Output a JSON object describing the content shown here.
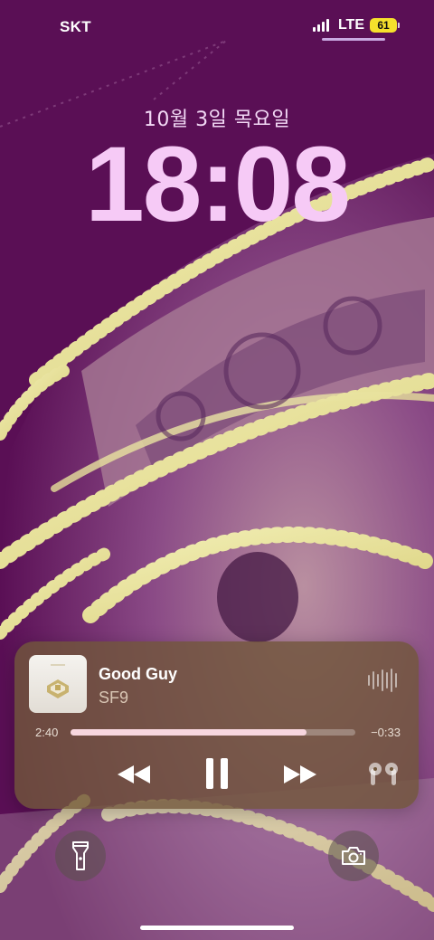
{
  "status_bar": {
    "carrier": "SKT",
    "network": "LTE",
    "battery": "61",
    "battery_level": 0.61,
    "signal_bars": 4
  },
  "lock": {
    "date": "10월 3일 목요일",
    "time": "18:08"
  },
  "now_playing": {
    "title": "Good Guy",
    "artist": "SF9",
    "elapsed": "2:40",
    "remaining": "−0:33",
    "progress": 0.83,
    "artwork_icon": "album-artwork",
    "controls": [
      "rewind-icon",
      "pause-icon",
      "fast-forward-icon",
      "airpods-icon"
    ]
  },
  "quick_actions": {
    "left": "flashlight-icon",
    "right": "camera-icon"
  },
  "colors": {
    "wallpaper_bg": "#5a0f55",
    "wallpaper_gold": "#e8e49a",
    "clock": "#f6caf6",
    "battery": "#f6e12c",
    "player_bg": "#70563a"
  }
}
